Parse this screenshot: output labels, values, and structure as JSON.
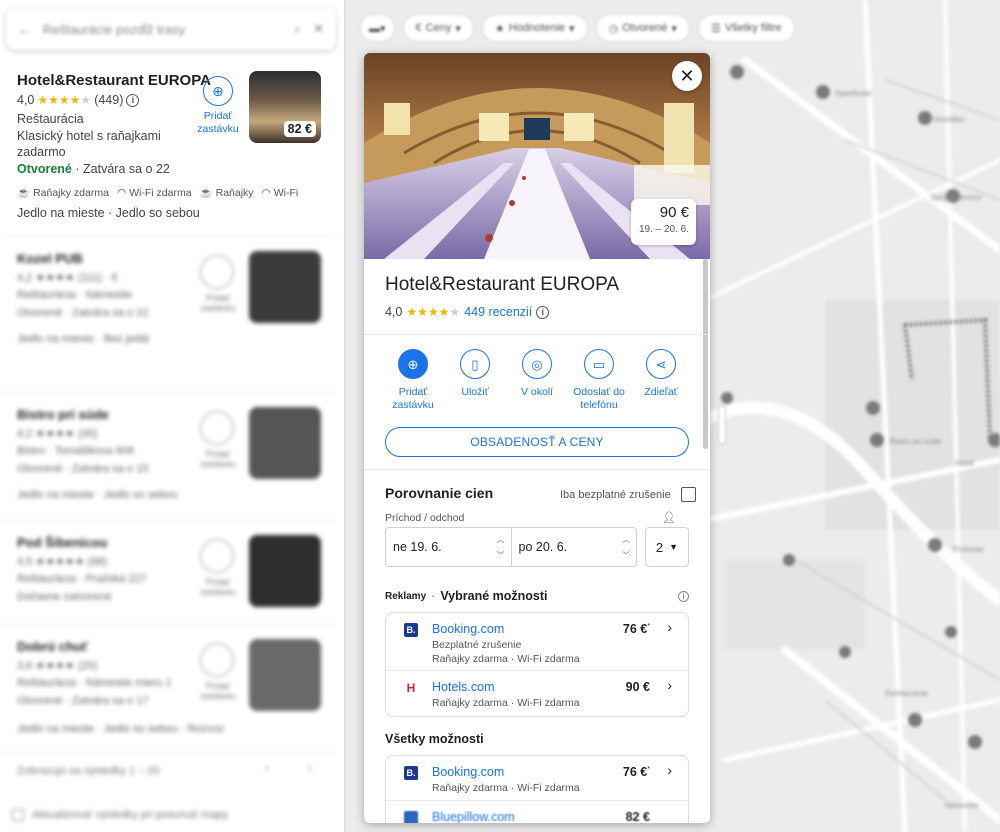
{
  "search": {
    "placeholder": "Reštaurácie pozdĺž trasy"
  },
  "filters": [
    "Ceny",
    "Hodnotenie",
    "Otvorené",
    "Všetky filtre"
  ],
  "first_result": {
    "name": "Hotel&Restaurant EUROPA",
    "rating": "4,0",
    "reviews": "(449)",
    "category": "Reštaurácia",
    "description": "Klasický hotel s raňajkami zadarmo",
    "status_open": "Otvorené",
    "status_close": "Zatvára sa o 22",
    "amenities": [
      "Raňajky zdarma",
      "Wi-Fi zdarma",
      "Raňajky",
      "Wi-Fi"
    ],
    "services": "Jedlo na mieste · Jedlo so sebou",
    "add_stop": "Pridať zastávku",
    "price": "82 €"
  },
  "other_results": [
    {
      "name": "Kozel PUB",
      "line1": "4,2 ★★★★ (111) · €",
      "line2": "Reštaurácia · Námestie",
      "line3": "Otvorené · Zatvára sa o 22",
      "line4": "Jedlo na mieste · Bez jedál",
      "add_stop": "Pridať zastávku",
      "swatch": "#3b3b3b"
    },
    {
      "name": "Bistro pri súde",
      "line1": "4,2 ★★★★ (35)",
      "line2": "Bistro · Tomášikova 806",
      "line3": "Otvorené · Zatvára sa o 15",
      "line4": "Jedlo na mieste · Jedlo so sebou",
      "add_stop": "Pridať zastávku",
      "swatch": "#555555"
    },
    {
      "name": "Pod Šibenicou",
      "line1": "4,5 ★★★★★ (98)",
      "line2": "Reštaurácia · Pražská 227",
      "line3": "Dočasne zatvorené",
      "line4": "",
      "add_stop": "Pridať zastávku",
      "swatch": "#2e2e2e"
    },
    {
      "name": "Dobrú chuť",
      "line1": "3,6 ★★★★ (25)",
      "line2": "Reštaurácia · Námestie mieru 1",
      "line3": "Otvorené · Zatvára sa o 17",
      "line4": "Jedlo na mieste · Jedlo so sebou · Rozvoz",
      "add_stop": "Pridať zastávku",
      "swatch": "#6a6a6a"
    }
  ],
  "left_footer": {
    "pagination": "Zobrazujú sa výsledky 1 – 20",
    "checkbox": "Aktualizovať výsledky pri posunutí mapy"
  },
  "card": {
    "hero_price": "90 €",
    "hero_dates": "19. – 20. 6.",
    "name": "Hotel&Restaurant EUROPA",
    "rating": "4,0",
    "reviews_link": "449 recenzií",
    "actions": [
      {
        "icon": "add-stop-icon",
        "label": "Pridať zastávku"
      },
      {
        "icon": "bookmark-icon",
        "label": "Uložiť"
      },
      {
        "icon": "nearby-icon",
        "label": "V okolí"
      },
      {
        "icon": "send-to-phone-icon",
        "label": "Odoslať do telefónu"
      },
      {
        "icon": "share-icon",
        "label": "Zdieľať"
      }
    ],
    "occupancy_button": "OBSADENOSŤ A CENY",
    "compare_title": "Porovnanie cien",
    "free_cancel_label": "Iba bezplatné zrušenie",
    "dates_label": "Príchod / odchod",
    "check_in": "ne 19. 6.",
    "check_out": "po 20. 6.",
    "guests": "2",
    "ads_label": "Reklamy",
    "ads_section": "Vybrané možnosti",
    "featured_offers": [
      {
        "site": "Booking.com",
        "sub1": "Bezplatné zrušenie",
        "sub2": "Raňajky zdarma · Wi-Fi zdarma",
        "price": "76 €",
        "mark": "*",
        "logo": "B."
      },
      {
        "site": "Hotels.com",
        "sub1": "Raňajky zdarma · Wi-Fi zdarma",
        "sub2": "",
        "price": "90 €",
        "mark": "",
        "logo": "H"
      }
    ],
    "all_title": "Všetky možnosti",
    "all_offers": [
      {
        "site": "Booking.com",
        "sub1": "Raňajky zdarma · Wi-Fi zdarma",
        "price": "76 €",
        "mark": "*",
        "logo": "B."
      },
      {
        "site": "Bluepillow.com",
        "price": "82 €"
      }
    ]
  },
  "colors": {
    "accent": "#1a73e8",
    "open_green": "#188038",
    "star": "#f5b400"
  }
}
